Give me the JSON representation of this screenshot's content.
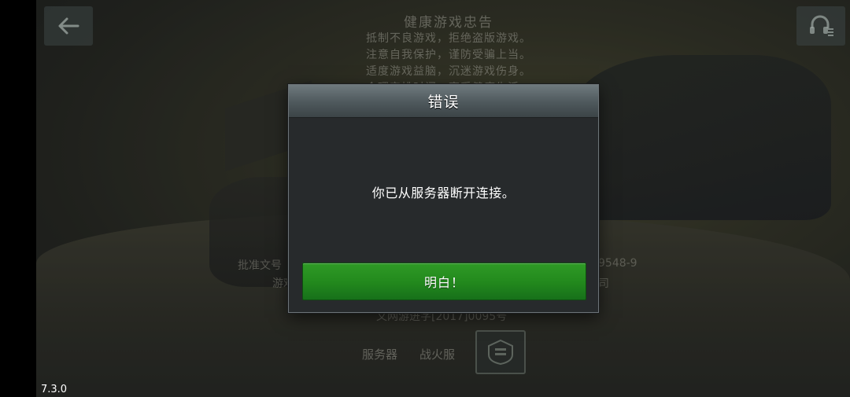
{
  "app": {
    "version": "7.3.0"
  },
  "background": {
    "notice_title": "健康游戏忠告",
    "notice_lines": [
      "抵制不良游戏，拒绝盗版游戏。",
      "注意自我保护，谨防受骗上当。",
      "适度游戏益脑，沉迷游戏伤身。",
      "合理安排时间，享受健康生活。"
    ],
    "approval_left": "批准文号",
    "approval_left2": "游戏",
    "approval_right": "9548-9",
    "approval_right2": "司",
    "culture_line": "文网游进字[2017]0095号",
    "server_label": "服务器",
    "server_value": "战火服"
  },
  "icons": {
    "back": "arrow-left-icon",
    "settings": "headset-menu-icon",
    "server": "server-emblem-icon"
  },
  "dialog": {
    "title": "错误",
    "message": "你已从服务器断开连接。",
    "confirm_label": "明白！"
  },
  "colors": {
    "accent_green": "#238a1d",
    "dialog_bg": "#272a2c",
    "header_gray": "#5a6468"
  }
}
